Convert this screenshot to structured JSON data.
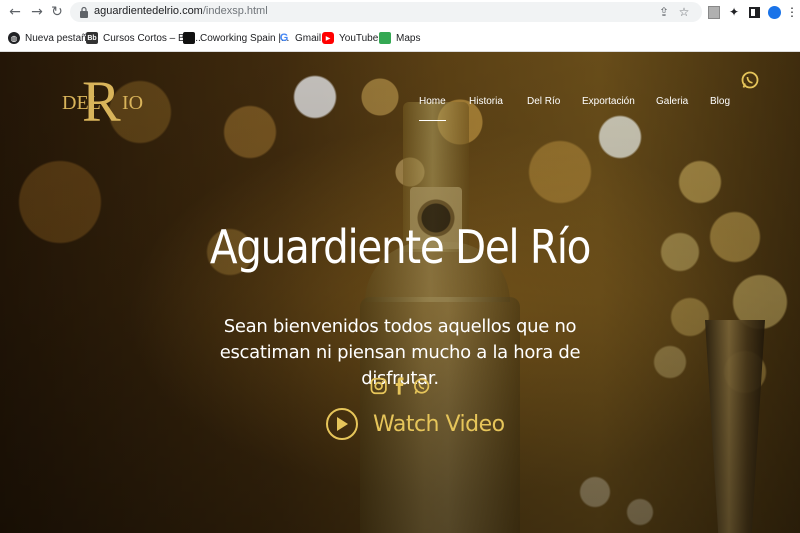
{
  "browser": {
    "url_domain": "aguardientedelrio.com",
    "url_path": "/indexsp.html",
    "bookmarks": [
      {
        "label": "Nueva pestaña",
        "icon": "globe-icon",
        "color": "#202124"
      },
      {
        "label": "Cursos Cortos – Bla...",
        "icon": "bb-icon",
        "color": "#202124"
      },
      {
        "label": "Coworking Spain |...",
        "icon": "hexagon-icon",
        "color": "#202124"
      },
      {
        "label": "Gmail",
        "icon": "google-icon",
        "color": "#4285f4"
      },
      {
        "label": "YouTube",
        "icon": "youtube-icon",
        "color": "#ff0000"
      },
      {
        "label": "Maps",
        "icon": "maps-icon",
        "color": "#34a853"
      }
    ]
  },
  "site": {
    "logo": {
      "del": "DEL",
      "r": "R",
      "io": "IO"
    },
    "menu": [
      "Home",
      "Historia",
      "Del Río",
      "Exportación",
      "Galeria",
      "Blog"
    ],
    "active_menu": "Home",
    "hero": {
      "title": "Aguardiente Del Río",
      "subtitle": "Sean bienvenidos todos aquellos que no escatiman ni piensan mucho a la hora de disfrutar.",
      "watch_label": "Watch Video"
    },
    "accent_color": "#e6c55a"
  }
}
